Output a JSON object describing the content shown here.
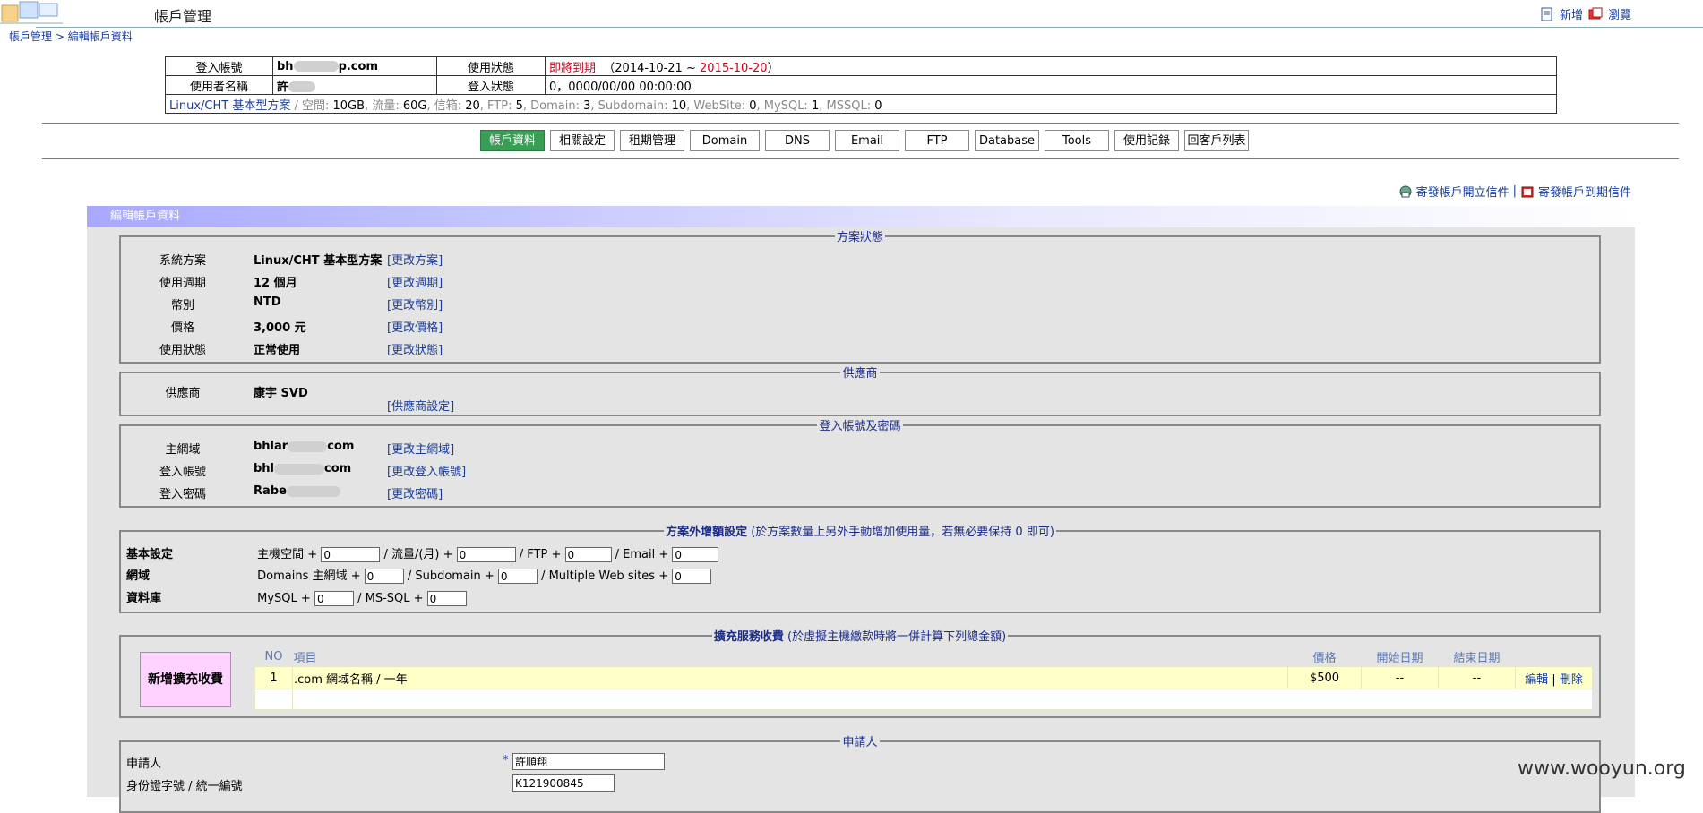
{
  "header": {
    "title": "帳戶管理",
    "add_label": "新增",
    "browse_label": "瀏覽"
  },
  "breadcrumb": {
    "root": "帳戶管理",
    "sep": " > ",
    "current": "編輯帳戶資料"
  },
  "info": {
    "login_label": "登入帳號",
    "login_value": "bh",
    "login_value_end": "p.com",
    "status_label": "使用狀態",
    "status_value": "即將到期",
    "status_range_start": "（2014-10-21 ~ ",
    "status_range_end": "2015-10-20",
    "status_range_close": "）",
    "user_label": "使用者名稱",
    "user_value": "許",
    "login_state_label": "登入狀態",
    "login_state_value": "0，0000/00/00 00:00:00",
    "plan_link": "Linux/CHT 基本型方案",
    "plan_space_label": " / 空間: ",
    "plan_space": "10GB",
    "plan_flow_label": ", 流量: ",
    "plan_flow": "60G",
    "plan_mail_label": ", 信箱: ",
    "plan_mail": "20",
    "plan_ftp_label": ", FTP: ",
    "plan_ftp": "5",
    "plan_domain_label": ", Domain: ",
    "plan_domain": "3",
    "plan_sub_label": ", Subdomain: ",
    "plan_sub": "10",
    "plan_web_label": ", WebSite: ",
    "plan_web": "0",
    "plan_mysql_label": ", MySQL: ",
    "plan_mysql": "1",
    "plan_mssql_label": ", MSSQL: ",
    "plan_mssql": "0"
  },
  "tabs": [
    "帳戶資料",
    "相關設定",
    "租期管理",
    "Domain",
    "DNS",
    "Email",
    "FTP",
    "Database",
    "Tools",
    "使用記錄",
    "回客戶列表"
  ],
  "mail_links": {
    "open_letter": "寄發帳戶開立信件",
    "sep": "|",
    "expire_letter": "寄發帳戶到期信件"
  },
  "panel_title": "編輯帳戶資料",
  "plan_status": {
    "legend": "方案狀態",
    "rows": [
      {
        "label": "系統方案",
        "value": "Linux/CHT 基本型方案",
        "action": "[更改方案]"
      },
      {
        "label": "使用週期",
        "value": "12 個月",
        "action": "[更改週期]"
      },
      {
        "label": "幣別",
        "value": "NTD",
        "action": "[更改幣別]"
      },
      {
        "label": "價格",
        "value": "3,000 元",
        "action": "[更改價格]"
      },
      {
        "label": "使用狀態",
        "value": "正常使用",
        "action": "[更改狀態]"
      }
    ]
  },
  "supplier": {
    "legend": "供應商",
    "label": "供應商",
    "value": "康宇 SVD",
    "action": "[供應商設定]"
  },
  "credentials": {
    "legend": "登入帳號及密碼",
    "rows": [
      {
        "label": "主網域",
        "value": "bhlar",
        "value_end": "com",
        "action": "[更改主網域]"
      },
      {
        "label": "登入帳號",
        "value": "bhl",
        "value_end": "com",
        "action": "[更改登入帳號]"
      },
      {
        "label": "登入密碼",
        "value": "Rabe",
        "value_end": "",
        "action": "[更改密碼]"
      }
    ]
  },
  "extra": {
    "legend_bold": "方案外增額設定",
    "legend_note": " (於方案數量上另外手動增加使用量，若無必要保持 0 即可)",
    "basic_label": "基本設定",
    "basic_space": "主機空間 +",
    "basic_flow": "/ 流量/(月) +",
    "basic_ftp": "/ FTP +",
    "basic_email": "/ Email +",
    "domain_label": "網域",
    "domain_main": "Domains 主網域 +",
    "domain_sub": "/ Subdomain +",
    "domain_web": "/ Multiple Web sites +",
    "db_label": "資料庫",
    "db_mysql": "MySQL +",
    "db_mssql": "/ MS-SQL +",
    "zero": "0"
  },
  "services": {
    "legend_bold": "擴充服務收費",
    "legend_note": " (於虛擬主機繳款時將一併計算下列總金額)",
    "add_button": "新增擴充收費",
    "col_no": "NO",
    "col_item": "項目",
    "col_price": "價格",
    "col_start": "開始日期",
    "col_end": "結束日期",
    "row_no": "1",
    "row_item": ".com 網域名稱 / 一年",
    "row_price": "$500",
    "row_start": "--",
    "row_end": "--",
    "row_edit": "編輯",
    "row_sep": " | ",
    "row_delete": "刪除"
  },
  "applicant": {
    "legend": "申請人",
    "name_label": "申請人",
    "required_mark": "*",
    "name_value": "許順翔",
    "id_label": "身份證字號 / 統一編號",
    "id_value": "K121900845"
  },
  "watermark": "www.wooyun.org"
}
